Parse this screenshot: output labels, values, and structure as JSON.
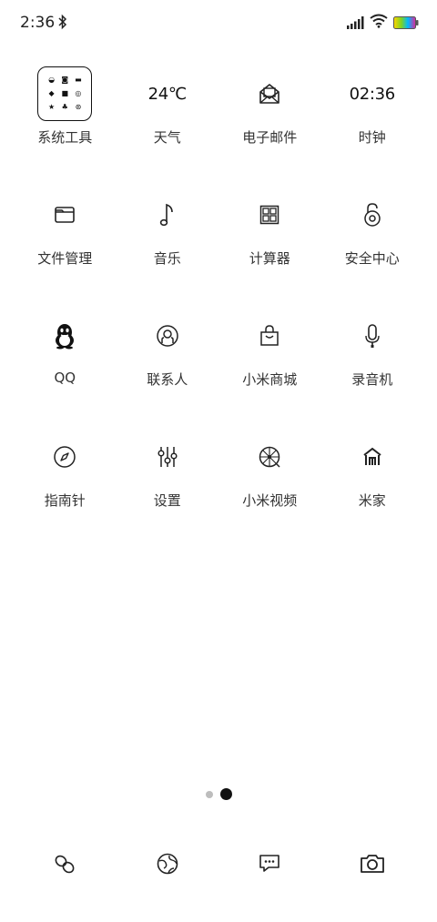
{
  "status_bar": {
    "time": "2:36",
    "icons": [
      "bluetooth-icon",
      "signal-icon",
      "wifi-icon",
      "battery-icon"
    ]
  },
  "apps": [
    {
      "label": "系统工具",
      "icon": "folder-icon",
      "icon_text": ""
    },
    {
      "label": "天气",
      "icon": "weather-widget",
      "icon_text": "24℃"
    },
    {
      "label": "电子邮件",
      "icon": "mail-icon",
      "icon_text": ""
    },
    {
      "label": "时钟",
      "icon": "clock-widget",
      "icon_text": "02:36"
    },
    {
      "label": "文件管理",
      "icon": "folder-file-icon",
      "icon_text": ""
    },
    {
      "label": "音乐",
      "icon": "music-note-icon",
      "icon_text": ""
    },
    {
      "label": "计算器",
      "icon": "calculator-icon",
      "icon_text": ""
    },
    {
      "label": "安全中心",
      "icon": "security-lock-icon",
      "icon_text": ""
    },
    {
      "label": "QQ",
      "icon": "qq-penguin-icon",
      "icon_text": ""
    },
    {
      "label": "联系人",
      "icon": "contacts-icon",
      "icon_text": ""
    },
    {
      "label": "小米商城",
      "icon": "shopping-bag-icon",
      "icon_text": ""
    },
    {
      "label": "录音机",
      "icon": "microphone-icon",
      "icon_text": ""
    },
    {
      "label": "指南针",
      "icon": "compass-icon",
      "icon_text": ""
    },
    {
      "label": "设置",
      "icon": "settings-sliders-icon",
      "icon_text": ""
    },
    {
      "label": "小米视频",
      "icon": "video-reel-icon",
      "icon_text": ""
    },
    {
      "label": "米家",
      "icon": "mijia-home-icon",
      "icon_text": ""
    }
  ],
  "page_indicator": {
    "pages": 2,
    "current": 2
  },
  "dock": [
    {
      "icon": "phone-icon"
    },
    {
      "icon": "browser-globe-icon"
    },
    {
      "icon": "messages-icon"
    },
    {
      "icon": "camera-icon"
    }
  ]
}
